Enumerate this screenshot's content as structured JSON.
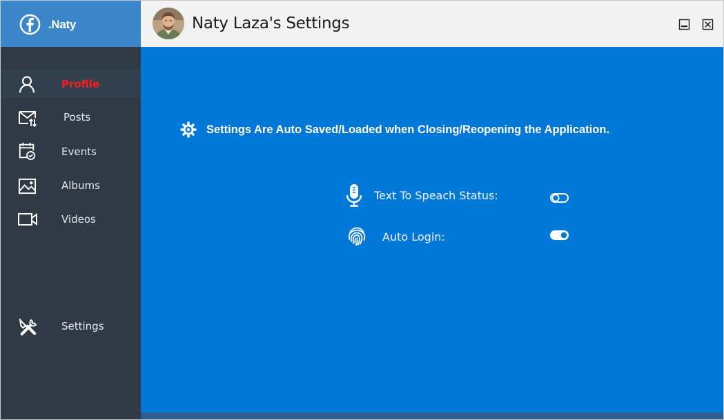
{
  "brand": {
    "name": ".Naty"
  },
  "sidebar": {
    "items": [
      {
        "label": "Profile",
        "icon": "user-icon",
        "active": true
      },
      {
        "label": "Posts",
        "icon": "mail-icon",
        "active": false
      },
      {
        "label": "Events",
        "icon": "calendar-check-icon",
        "active": false
      },
      {
        "label": "Albums",
        "icon": "image-icon",
        "active": false
      },
      {
        "label": "Videos",
        "icon": "video-camera-icon",
        "active": false
      },
      {
        "label": "Settings",
        "icon": "tools-icon",
        "active": false
      }
    ]
  },
  "titlebar": {
    "title": "Naty Laza's Settings",
    "avatar": "profile-avatar"
  },
  "main": {
    "notice": "Settings Are Auto Saved/Loaded when Closing/Reopening the Application.",
    "settings": [
      {
        "label": "Text To Speach Status:",
        "icon": "microphone-icon",
        "enabled": false
      },
      {
        "label": "Auto Login:",
        "icon": "fingerprint-icon",
        "enabled": true
      }
    ]
  },
  "colors": {
    "sidebar": "#2f3a46",
    "brand_bar": "#3a86c9",
    "main_panel": "#0078d7",
    "active_label": "#ff1a1a",
    "titlebar": "#f2f2f2"
  }
}
